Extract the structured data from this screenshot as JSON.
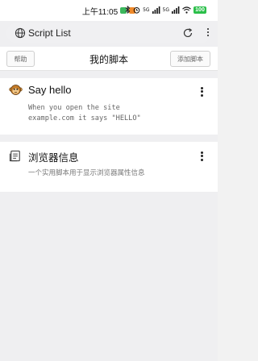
{
  "status_bar": {
    "time": "上午11:05",
    "battery": "100",
    "signal_labels": [
      "5G",
      "5G"
    ]
  },
  "browser": {
    "url_text": "Script List",
    "icons": [
      "globe-icon",
      "reload-icon",
      "more-vert-icon"
    ]
  },
  "toolbar": {
    "help_label": "帮助",
    "title": "我的脚本",
    "add_label": "添加脚本"
  },
  "scripts": [
    {
      "title": "Say hello",
      "description": "When you open the site\nexample.com it says \"HELLO\"",
      "icon": "monkey-icon"
    },
    {
      "title": "浏览器信息",
      "description": "一个实用脚本用于显示浏览器属性信息",
      "icon": "document-icon"
    }
  ],
  "colors": {
    "page_bg": "#efeff1",
    "card_bg": "#ffffff",
    "battery": "#2bbf4a",
    "text_secondary": "#666666"
  }
}
